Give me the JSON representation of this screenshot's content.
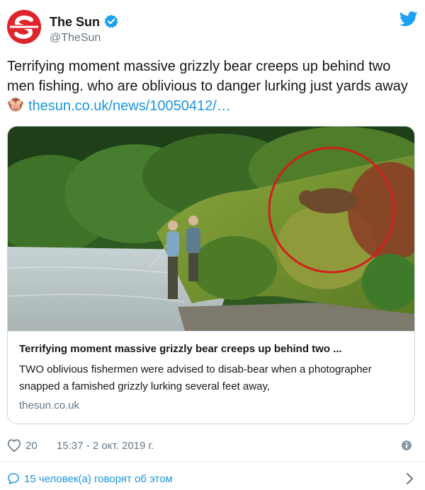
{
  "account": {
    "name": "The Sun",
    "handle": "@TheSun"
  },
  "tweet": {
    "text": "Terrifying moment massive grizzly bear creeps up behind two men fishing. who are oblivious to danger lurking just yards away",
    "emoji": "see-no-evil-monkey",
    "link": "thesun.co.uk/news/10050412/…"
  },
  "card": {
    "title": "Terrifying moment massive grizzly bear creeps up behind two ...",
    "description": "TWO oblivious fishermen were advised to disab-bear when a photographer snapped a famished grizzly lurking several feet away,",
    "domain": "thesun.co.uk"
  },
  "meta": {
    "likes": "20",
    "timestamp": "15:37 - 2 окт. 2019 г."
  },
  "footer": {
    "conversation": "15 человек(а) говорят об этом"
  },
  "colors": {
    "brand_red": "#e0242b",
    "twitter_blue": "#1b95e0",
    "text": "#14171a",
    "muted": "#657786"
  }
}
